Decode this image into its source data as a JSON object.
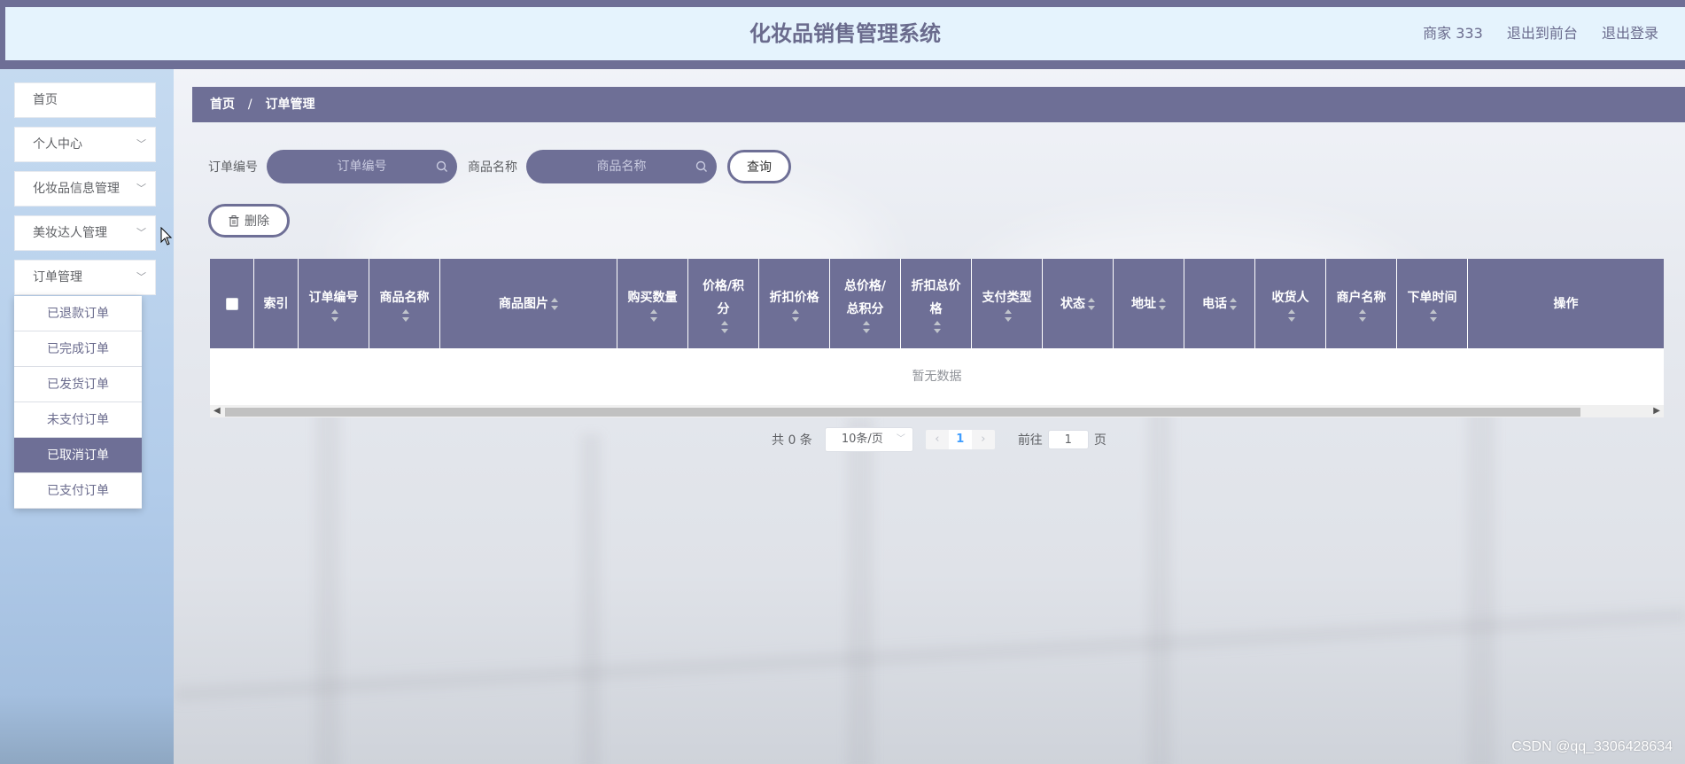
{
  "header": {
    "title": "化妆品销售管理系统",
    "user_label": "商家 333",
    "back_to_front": "退出到前台",
    "logout": "退出登录"
  },
  "sidebar": {
    "items": [
      {
        "label": "首页",
        "has_children": false
      },
      {
        "label": "个人中心",
        "has_children": true
      },
      {
        "label": "化妆品信息管理",
        "has_children": true
      },
      {
        "label": "美妆达人管理",
        "has_children": true
      },
      {
        "label": "订单管理",
        "has_children": true
      }
    ],
    "submenu": [
      {
        "label": "已退款订单"
      },
      {
        "label": "已完成订单"
      },
      {
        "label": "已发货订单"
      },
      {
        "label": "未支付订单"
      },
      {
        "label": "已取消订单",
        "active": true
      },
      {
        "label": "已支付订单"
      }
    ]
  },
  "breadcrumb": {
    "home": "首页",
    "separator": "/",
    "current": "订单管理"
  },
  "search": {
    "order_no_label": "订单编号",
    "order_no_placeholder": "订单编号",
    "product_name_label": "商品名称",
    "product_name_placeholder": "商品名称",
    "query_button": "查询"
  },
  "toolbar": {
    "delete_button": "删除"
  },
  "table": {
    "columns": [
      {
        "label": "",
        "type": "checkbox"
      },
      {
        "label": "索引",
        "sortable": false
      },
      {
        "label": "订单编号",
        "sortable": true
      },
      {
        "label": "商品名称",
        "sortable": true
      },
      {
        "label": "商品图片",
        "sortable": true
      },
      {
        "label": "购买数量",
        "sortable": true
      },
      {
        "label": "价格/积分",
        "sortable": true
      },
      {
        "label": "折扣价格",
        "sortable": true
      },
      {
        "label": "总价格/总积分",
        "sortable": true
      },
      {
        "label": "折扣总价格",
        "sortable": true
      },
      {
        "label": "支付类型",
        "sortable": true
      },
      {
        "label": "状态",
        "sortable": true
      },
      {
        "label": "地址",
        "sortable": true
      },
      {
        "label": "电话",
        "sortable": true
      },
      {
        "label": "收货人",
        "sortable": true
      },
      {
        "label": "商户名称",
        "sortable": true
      },
      {
        "label": "下单时间",
        "sortable": true
      },
      {
        "label": "操作",
        "sortable": false
      }
    ],
    "empty_text": "暂无数据"
  },
  "pagination": {
    "total_text": "共 0 条",
    "page_size": "10条/页",
    "current_page": "1",
    "goto_label": "前往",
    "goto_value": "1",
    "page_unit": "页"
  },
  "watermark": "CSDN @qq_3306428634",
  "colors": {
    "primary": "#6e6f96",
    "header_bg": "#e5f3fd",
    "sidebar_bg": "#b8d0ec"
  }
}
